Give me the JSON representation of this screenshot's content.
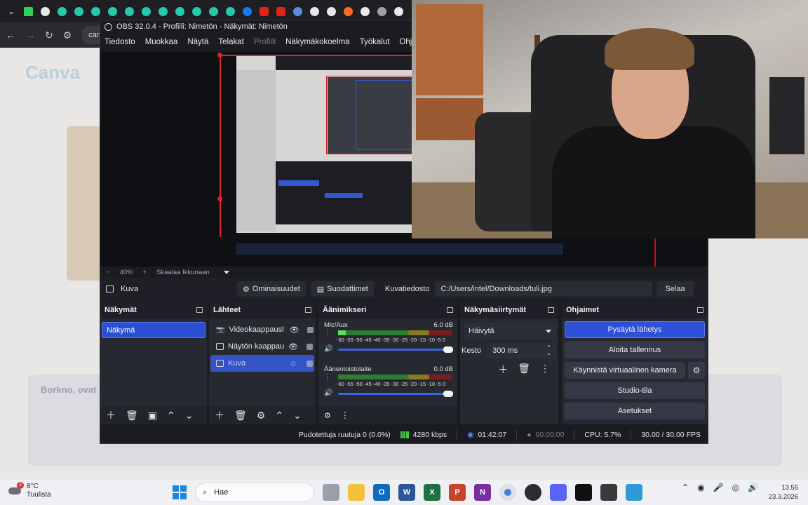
{
  "browser": {
    "url_fragment": "can",
    "page_logo": "Canva",
    "card_title": "Borkno, ovat"
  },
  "obs": {
    "title": "OBS 32.0.4 - Profiili: Nimetön - Näkymät: Nimetön",
    "menu": [
      "Tiedosto",
      "Muokkaa",
      "Näytä",
      "Telakat",
      "Profiili",
      "Näkymäkokoelma",
      "Työkalut",
      "Ohje"
    ],
    "zoom": {
      "minus": "−",
      "value": "40%",
      "plus": "+",
      "mode": "Skaalaa Ikkunaan"
    },
    "source_toolbar": {
      "source_name": "Kuva",
      "properties": "Ominaisuudet",
      "filters": "Suodattimet",
      "file_label": "Kuvatiedosto",
      "file_path": "C:/Users/intel/Downloads/tuli.jpg",
      "browse": "Selaa"
    },
    "scenes": {
      "title": "Näkymät",
      "items": [
        "Näkymä"
      ]
    },
    "sources": {
      "title": "Lähteet",
      "items": [
        {
          "label": "Videokaappausl"
        },
        {
          "label": "Näytön kaappau"
        },
        {
          "label": "Kuva"
        }
      ]
    },
    "mixer": {
      "title": "Äänimikseri",
      "channels": [
        {
          "name": "Mic/Aux",
          "db": "6.0 dB",
          "level": 0.07
        },
        {
          "name": "Äänentoistolaite",
          "db": "0.0 dB",
          "level": 0
        }
      ],
      "scale": "-60 -55 -50 -45 -40 -35 -30 -25 -20 -15 -10 -5 0"
    },
    "transitions": {
      "title": "Näkymäsiirtymät",
      "selected": "Häivytä",
      "duration_label": "Kesto",
      "duration_value": "300 ms"
    },
    "controls": {
      "title": "Ohjaimet",
      "buttons": {
        "stop_stream": "Pysäytä lähetys",
        "start_record": "Aloita tallennus",
        "virtual_cam": "Käynnistä virtuaalinen kamera",
        "studio": "Studio-tila",
        "settings": "Asetukset"
      }
    },
    "status": {
      "dropped": "Pudotettuja ruutuja 0 (0.0%)",
      "bitrate": "4280 kbps",
      "stream_time": "01:42:07",
      "record_time": "00:00:00",
      "cpu": "CPU: 5.7%",
      "fps": "30.00 / 30.00 FPS"
    }
  },
  "taskbar": {
    "weather_temp": "8°C",
    "weather_text": "Tuulista",
    "weather_badge": "2",
    "search_placeholder": "Hae",
    "time": "13.55",
    "date": "23.3.2026"
  }
}
